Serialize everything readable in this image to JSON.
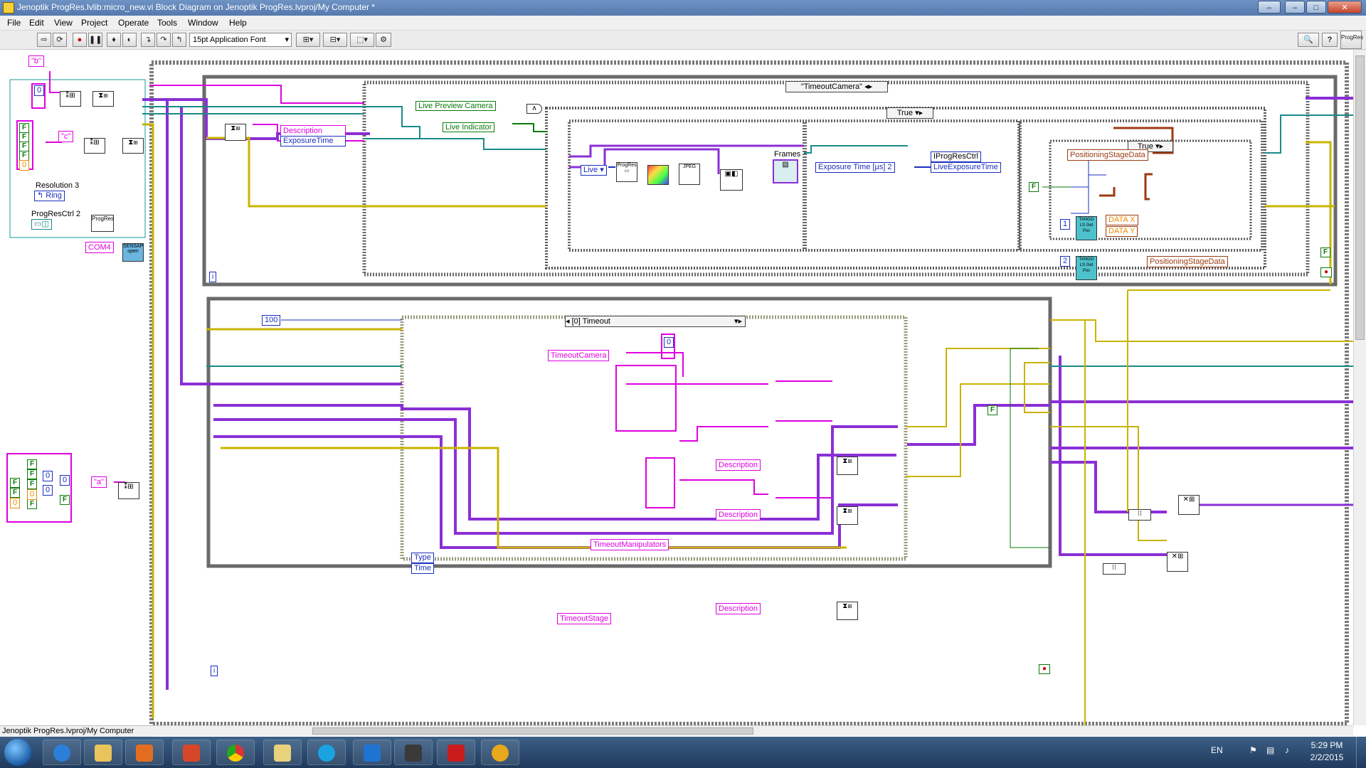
{
  "window": {
    "title": "Jenoptik ProgRes.lvlib:micro_new.vi Block Diagram on Jenoptik ProgRes.lvproj/My Computer *",
    "buttons": {
      "resize": "⇔",
      "minimize": "–",
      "maximize": "□",
      "close": "✕"
    }
  },
  "menu": [
    "File",
    "Edit",
    "View",
    "Project",
    "Operate",
    "Tools",
    "Window",
    "Help"
  ],
  "toolbar": {
    "font": "15pt Application Font",
    "help": "?"
  },
  "colors": {
    "string": "#e000e0",
    "boolean": "#0a7a0a",
    "numeric": "#1b2fbf",
    "cluster": "#8b2fd6",
    "refnum": "#1a8a8a",
    "error": "#c8b400",
    "dbl": "#f08a00",
    "case_border": "#8a8a8a",
    "taskbar": "#1e3a5c"
  },
  "diagram": {
    "left": {
      "const_b": "\"b\"",
      "const_c": "\"c\"",
      "const_a": "\"a\"",
      "zero": "0",
      "resolution_label": "Resolution 3",
      "ring": "Ring",
      "progres_label": "ProgResCtrl 2",
      "com": "COM4",
      "bool_cluster": [
        "F",
        "F",
        "F",
        "F",
        "0"
      ],
      "bottom_cluster": [
        "F",
        "F",
        "F",
        "F",
        "F",
        "F",
        "F"
      ],
      "bottom_nums": [
        "0",
        "0",
        "0",
        "0",
        "0"
      ]
    },
    "upper": {
      "timeout_case": "\"TimeoutCamera\"",
      "true_case": "True",
      "true_case_inner": "True",
      "description": "Description",
      "exposure_time": "ExposureTime",
      "live_preview": "Live Preview Camera",
      "live_indicator": "Live Indicator",
      "live_enum": "Live",
      "frames": "Frames",
      "exposure_ctrl": "Exposure Time [µs] 2",
      "iprogres": "IProgResCtrl",
      "live_exposure": "LiveExposureTime",
      "positioning_in": "PositioningStageData",
      "positioning_out": "PositioningStageData",
      "data_x": "DATA X",
      "data_y": "DATA Y",
      "tango_1": "1",
      "tango_2": "2",
      "tango_label": "TANGO LS Get Pos",
      "bool_F": "F",
      "info": "i"
    },
    "lower": {
      "timeout_case": "[0] Timeout",
      "const_100": "100",
      "timeout_camera": "TimeoutCamera",
      "timeout_manipulators": "TimeoutManipulators",
      "timeout_stage": "TimeoutStage",
      "description_1": "Description",
      "description_2": "Description",
      "description_3": "Description",
      "type": "Type",
      "time": "Time",
      "bool_F": "F",
      "zero": "0",
      "info": "i"
    }
  },
  "status": {
    "project": "Jenoptik ProgRes.lvproj/My Computer"
  },
  "taskbar": {
    "apps": [
      "internet-explorer",
      "file-explorer",
      "media-player",
      "matlab",
      "chrome",
      "labview",
      "skype",
      "teamviewer",
      "media-encoder",
      "pdf",
      "misc"
    ],
    "lang": "EN",
    "time": "5:29 PM",
    "date": "2/2/2015"
  }
}
